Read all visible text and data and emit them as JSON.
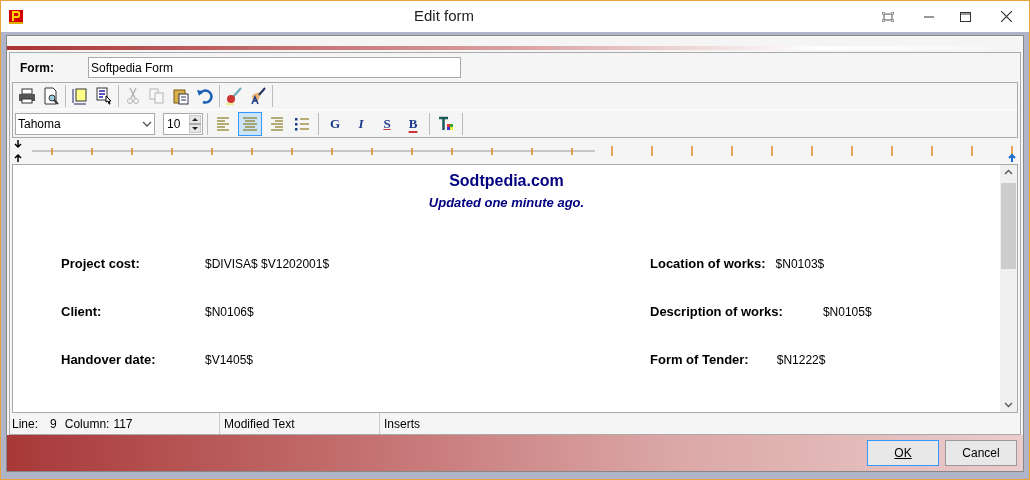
{
  "window": {
    "title": "Edit form"
  },
  "form": {
    "label": "Form:",
    "value": "Softpedia Form"
  },
  "toolbar": [
    {
      "kind": "print",
      "disabled": false
    },
    {
      "kind": "preview",
      "disabled": false
    },
    {
      "kind": "sep"
    },
    {
      "kind": "page",
      "disabled": false
    },
    {
      "kind": "select",
      "disabled": false
    },
    {
      "kind": "sep"
    },
    {
      "kind": "cut",
      "disabled": true
    },
    {
      "kind": "copy",
      "disabled": true
    },
    {
      "kind": "paste",
      "disabled": false
    },
    {
      "kind": "undo",
      "disabled": false
    },
    {
      "kind": "sep"
    },
    {
      "kind": "brush",
      "disabled": false
    },
    {
      "kind": "pen",
      "disabled": false
    },
    {
      "kind": "sep"
    }
  ],
  "format": {
    "font": "Tahoma",
    "size": "10",
    "align": [
      {
        "kind": "left",
        "selected": false
      },
      {
        "kind": "center",
        "selected": true
      },
      {
        "kind": "right",
        "selected": false
      },
      {
        "kind": "bullets",
        "selected": false
      }
    ],
    "styles": [
      {
        "kind": "bold",
        "label": "G"
      },
      {
        "kind": "italic",
        "label": "I"
      },
      {
        "kind": "underline",
        "label": "S"
      },
      {
        "kind": "strike",
        "label": "B"
      }
    ]
  },
  "document": {
    "heading": "Sodtpedia.com",
    "subheading": "Updated one minute ago.",
    "rows": [
      {
        "left_label": "Project cost:",
        "left_value": "$DIVISA$ $V1202001$",
        "right_label": "Location of works:",
        "right_value": "$N0103$"
      },
      {
        "left_label": "Client:",
        "left_value": "$N0106$",
        "right_label": "Description of works:",
        "right_value": "$N0105$"
      },
      {
        "left_label": "Handover date:",
        "left_value": "$V1405$",
        "right_label": "Form of Tender:",
        "right_value": "$N1222$"
      }
    ]
  },
  "status_bar": [
    {
      "label": "Line:",
      "value": "9"
    },
    {
      "label": "Column:",
      "value": "117"
    },
    {
      "text": "Modified Text"
    },
    {
      "text": "Inserts"
    }
  ],
  "buttons": [
    {
      "label": "OK",
      "selected": true
    },
    {
      "label": "Cancel",
      "selected": false
    }
  ]
}
